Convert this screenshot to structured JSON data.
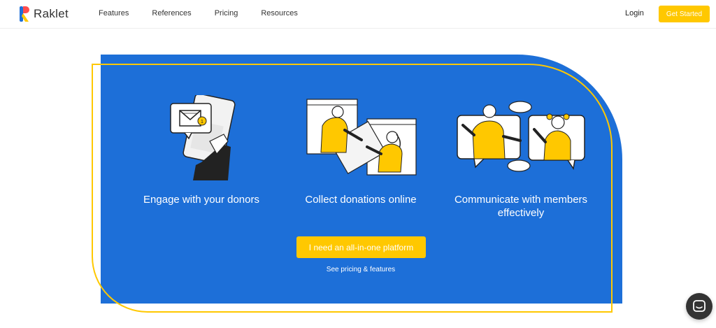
{
  "header": {
    "logo_text": "Raklet",
    "nav": [
      {
        "label": "Features"
      },
      {
        "label": "References"
      },
      {
        "label": "Pricing"
      },
      {
        "label": "Resources"
      }
    ],
    "login_label": "Login",
    "get_started_label": "Get Started"
  },
  "features": [
    {
      "title": "Engage with your donors",
      "icon": "donor-engagement-illustration"
    },
    {
      "title": "Collect donations online",
      "icon": "online-donation-illustration"
    },
    {
      "title": "Communicate with members effectively",
      "icon": "member-communication-illustration"
    }
  ],
  "cta": {
    "primary_label": "I need an all-in-one platform",
    "secondary_label": "See pricing & features"
  },
  "colors": {
    "brand_yellow": "#ffc800",
    "panel_blue": "#1d6fd8"
  },
  "chat": {
    "icon": "chat-icon"
  }
}
